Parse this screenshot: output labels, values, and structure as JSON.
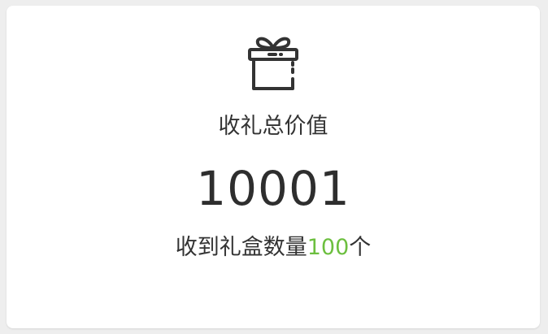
{
  "card": {
    "icon": "gift-icon",
    "title": "收礼总价值",
    "total_value": "10001",
    "count_prefix": "收到礼盒数量",
    "count_value": "100",
    "count_suffix": "个"
  },
  "colors": {
    "text": "#333333",
    "accent": "#6cbf3f",
    "card_bg": "#ffffff",
    "page_bg": "#eeeeee"
  }
}
